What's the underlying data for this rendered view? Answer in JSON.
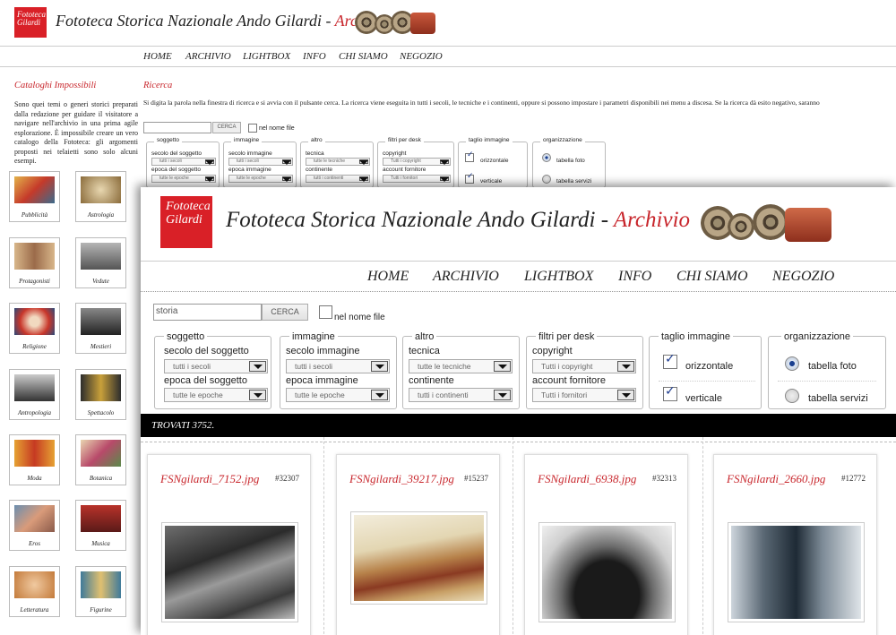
{
  "back": {
    "logo": [
      "Fototeca",
      "Gilardi"
    ],
    "title": "Fototeca Storica Nazionale Ando Gilardi",
    "title_dash": " - ",
    "title_archive": "Archivio",
    "nav": [
      "HOME",
      "ARCHIVIO",
      "LIGHTBOX",
      "INFO",
      "CHI SIAMO",
      "NEGOZIO"
    ],
    "sidebar_title": "Cataloghi Impossibili",
    "sidebar_text": "Sono quei temi o generi storici preparati dalla redazione per guidare il visitatore a navigare nell'archivio in una prima agile esplorazione. È impossibile creare un vero catalogo della Fototeca: gli argomenti proposti nei telaietti sono solo alcuni esempi.",
    "categories": [
      "Pubblicità",
      "Astrologia",
      "Protagonisti",
      "Vedute",
      "Religione",
      "Mestieri",
      "Antropologia",
      "Spettacolo",
      "Moda",
      "Botanica",
      "Eros",
      "Musica",
      "Letteratura",
      "Figurine"
    ],
    "search_title": "Ricerca",
    "search_text": "Si digita la parola nella finestra di ricerca e si avvia con il pulsante cerca. La ricerca viene eseguita in tutti i secoli, le tecniche e i continenti, oppure si possono impostare i parametri disponibili nei menu a discesa. Se la ricerca dà esito negativo, saranno",
    "search_button": "CERCA",
    "nel_nome_file": "nel nome file",
    "filters": {
      "soggetto": "soggetto",
      "secolo_soggetto": "secolo del soggetto",
      "tutti_secoli": "tutti i secoli",
      "epoca_soggetto": "epoca del soggetto",
      "tutte_epoche": "tutte le epoche",
      "immagine": "immagine",
      "secolo_immagine": "secolo immagine",
      "epoca_immagine": "epoca immagine",
      "altro": "altro",
      "tecnica": "tecnica",
      "tutte_tecniche": "tutte le tecniche",
      "continente": "continente",
      "tutti_continenti": "tutti i continenti",
      "filtri_desk": "filtri per desk",
      "copyright": "copyright",
      "tutti_copyright": "Tutti i copyright",
      "account_fornitore": "account fornitore",
      "tutti_fornitori": "Tutti i fornitori",
      "taglio": "taglio immagine",
      "orizzontale": "orizzontale",
      "verticale": "verticale",
      "organizzazione": "organizzazione",
      "tabella_foto": "tabella foto",
      "tabella_servizi": "tabella servizi"
    }
  },
  "front": {
    "logo": [
      "Fototeca",
      "Gilardi"
    ],
    "title": "Fototeca Storica Nazionale Ando Gilardi",
    "title_dash": " - ",
    "title_archive": "Archivio",
    "nav": [
      "HOME",
      "ARCHIVIO",
      "LIGHTBOX",
      "INFO",
      "CHI SIAMO",
      "NEGOZIO"
    ],
    "search_value": "storia",
    "search_button": "CERCA",
    "nel_nome_file": "nel nome file",
    "filters": {
      "soggetto": "soggetto",
      "secolo_soggetto": "secolo del soggetto",
      "tutti_secoli": "tutti i secoli",
      "epoca_soggetto": "epoca del soggetto",
      "tutte_epoche": "tutte le epoche",
      "immagine": "immagine",
      "secolo_immagine": "secolo immagine",
      "epoca_immagine": "epoca immagine",
      "altro": "altro",
      "tecnica": "tecnica",
      "tutte_tecniche": "tutte le tecniche",
      "continente": "continente",
      "tutti_continenti": "tutti i continenti",
      "filtri_desk": "filtri per desk",
      "copyright": "copyright",
      "tutti_copyright": "Tutti i copyright",
      "account_fornitore": "account fornitore",
      "tutti_fornitori": "Tutti i fornitori",
      "taglio": "taglio immagine",
      "orizzontale": "orizzontale",
      "verticale": "verticale",
      "organizzazione": "organizzazione",
      "tabella_foto": "tabella foto",
      "tabella_servizi": "tabella servizi"
    },
    "results_label": "TROVATI 3752.",
    "results": [
      {
        "file": "FSNgilardi_7152.jpg",
        "id": "#32307"
      },
      {
        "file": "FSNgilardi_39217.jpg",
        "id": "#15237"
      },
      {
        "file": "FSNgilardi_6938.jpg",
        "id": "#32313"
      },
      {
        "file": "FSNgilardi_2660.jpg",
        "id": "#12772"
      }
    ]
  },
  "colors": {
    "brand_red": "#d92027",
    "accent_red": "#c8262c",
    "results_bar": "#000000"
  }
}
